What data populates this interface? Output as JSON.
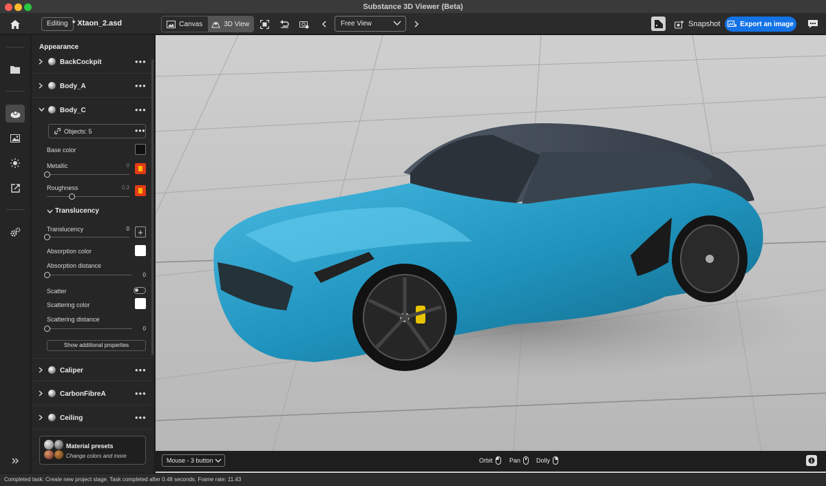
{
  "window": {
    "title": "Substance 3D Viewer (Beta)"
  },
  "toolbar": {
    "editing_label": "Editing",
    "file_name": "* Xtaon_2.asd",
    "canvas_label": "Canvas",
    "view3d_label": "3D View",
    "view_select": "Free View",
    "snapshot_label": "Snapshot",
    "export_label": "Export an image"
  },
  "panel": {
    "title": "Appearance",
    "materials_top": [
      {
        "name": "BackCockpit",
        "expanded": false
      },
      {
        "name": "Body_A",
        "expanded": false
      },
      {
        "name": "Body_C",
        "expanded": true
      }
    ],
    "objects_label": "Objects: 5",
    "base_color_label": "Base color",
    "metallic": {
      "label": "Metallic",
      "value": "0",
      "fraction": 0
    },
    "roughness": {
      "label": "Roughness",
      "value": "0.3",
      "fraction": 0.3
    },
    "translucency_section": "Translucency",
    "translucency": {
      "label": "Translucency",
      "value": "0",
      "fraction": 0
    },
    "absorption_color_label": "Absorption color",
    "absorption_distance": {
      "label": "Absorption distance",
      "value": "0",
      "fraction": 0
    },
    "scatter_label": "Scatter",
    "scattering_color_label": "Scattering color",
    "scattering_distance": {
      "label": "Scattering distance",
      "value": "0",
      "fraction": 0
    },
    "show_more_label": "Show additional properties",
    "materials_bottom": [
      {
        "name": "Caliper"
      },
      {
        "name": "CarbonFibreA"
      },
      {
        "name": "Ceiling"
      }
    ],
    "presets_title": "Material presets",
    "presets_subtitle": "Change colors and more"
  },
  "viewport": {
    "mouse_mode": "Mouse - 3 button",
    "orbit_label": "Orbit",
    "pan_label": "Pan",
    "dolly_label": "Dolly",
    "car_color": "#1f94be"
  },
  "status": {
    "text": "Completed task: Create new project stage. Task completed after 0.48 seconds. Frame rate: 11.43"
  },
  "colors": {
    "accent": "#1473e6",
    "metallic_swatch": "#e03a18"
  }
}
